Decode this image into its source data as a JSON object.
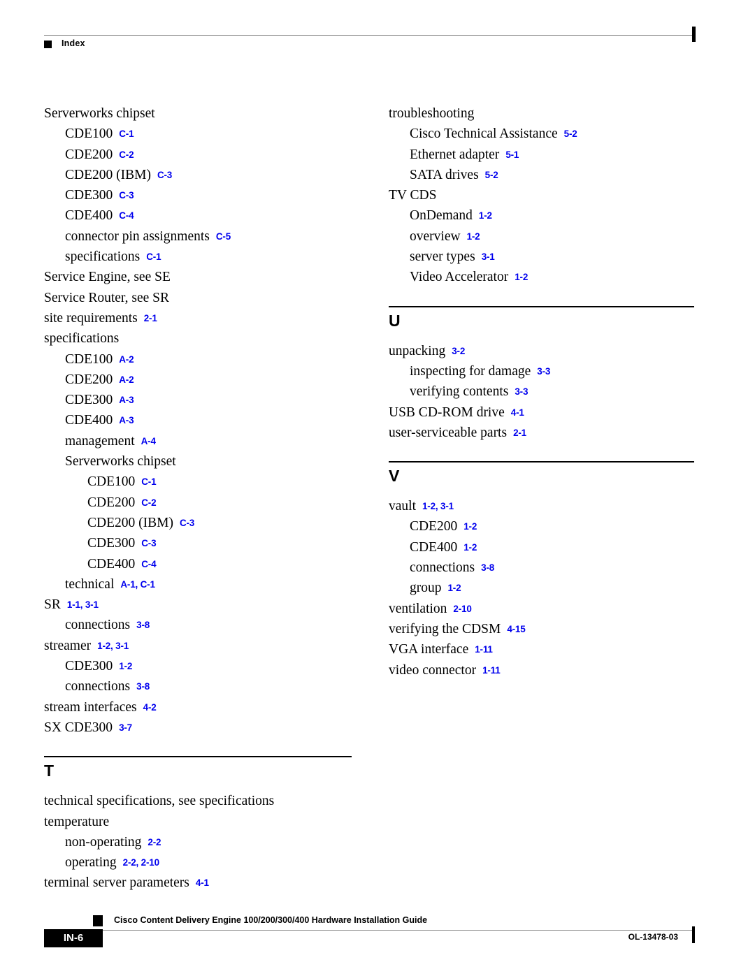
{
  "header": {
    "label": "Index"
  },
  "footer": {
    "page_number": "IN-6",
    "document_title": "Cisco Content Delivery Engine 100/200/300/400 Hardware Installation Guide",
    "doc_id": "OL-13478-03"
  },
  "colors": {
    "page_ref_blue": "#0000EE",
    "rule_gray": "#8a8a8a",
    "text_black": "#000000"
  },
  "columns": {
    "left": {
      "blocks": [
        {
          "type": "entries",
          "entries": [
            {
              "level": 0,
              "term": "Serverworks chipset",
              "refs": ""
            },
            {
              "level": 1,
              "term": "CDE100",
              "refs": "C-1"
            },
            {
              "level": 1,
              "term": "CDE200",
              "refs": "C-2"
            },
            {
              "level": 1,
              "term": "CDE200 (IBM)",
              "refs": "C-3"
            },
            {
              "level": 1,
              "term": "CDE300",
              "refs": "C-3"
            },
            {
              "level": 1,
              "term": "CDE400",
              "refs": "C-4"
            },
            {
              "level": 1,
              "term": "connector pin assignments",
              "refs": "C-5"
            },
            {
              "level": 1,
              "term": "specifications",
              "refs": "C-1"
            },
            {
              "level": 0,
              "term": "Service Engine, see SE",
              "refs": ""
            },
            {
              "level": 0,
              "term": "Service Router, see SR",
              "refs": ""
            },
            {
              "level": 0,
              "term": "site requirements",
              "refs": "2-1"
            },
            {
              "level": 0,
              "term": "specifications",
              "refs": ""
            },
            {
              "level": 1,
              "term": "CDE100",
              "refs": "A-2"
            },
            {
              "level": 1,
              "term": "CDE200",
              "refs": "A-2"
            },
            {
              "level": 1,
              "term": "CDE300",
              "refs": "A-3"
            },
            {
              "level": 1,
              "term": "CDE400",
              "refs": "A-3"
            },
            {
              "level": 1,
              "term": "management",
              "refs": "A-4"
            },
            {
              "level": 1,
              "term": "Serverworks chipset",
              "refs": ""
            },
            {
              "level": 2,
              "term": "CDE100",
              "refs": "C-1"
            },
            {
              "level": 2,
              "term": "CDE200",
              "refs": "C-2"
            },
            {
              "level": 2,
              "term": "CDE200 (IBM)",
              "refs": "C-3"
            },
            {
              "level": 2,
              "term": "CDE300",
              "refs": "C-3"
            },
            {
              "level": 2,
              "term": "CDE400",
              "refs": "C-4"
            },
            {
              "level": 1,
              "term": "technical",
              "refs": "A-1, C-1"
            },
            {
              "level": 0,
              "term": "SR",
              "refs": "1-1, 3-1"
            },
            {
              "level": 1,
              "term": "connections",
              "refs": "3-8"
            },
            {
              "level": 0,
              "term": "streamer",
              "refs": "1-2, 3-1"
            },
            {
              "level": 1,
              "term": "CDE300",
              "refs": "1-2"
            },
            {
              "level": 1,
              "term": "connections",
              "refs": "3-8"
            },
            {
              "level": 0,
              "term": "stream interfaces",
              "refs": "4-2"
            },
            {
              "level": 0,
              "term": "SX CDE300",
              "refs": "3-7"
            }
          ]
        },
        {
          "type": "letter",
          "letter": "T"
        },
        {
          "type": "entries",
          "entries": [
            {
              "level": 0,
              "term": "technical specifications, see specifications",
              "refs": ""
            },
            {
              "level": 0,
              "term": "temperature",
              "refs": ""
            },
            {
              "level": 1,
              "term": "non-operating",
              "refs": "2-2"
            },
            {
              "level": 1,
              "term": "operating",
              "refs": "2-2, 2-10"
            },
            {
              "level": 0,
              "term": "terminal server parameters",
              "refs": "4-1"
            }
          ]
        }
      ]
    },
    "right": {
      "blocks": [
        {
          "type": "entries",
          "entries": [
            {
              "level": 0,
              "term": "troubleshooting",
              "refs": ""
            },
            {
              "level": 1,
              "term": "Cisco Technical Assistance",
              "refs": "5-2"
            },
            {
              "level": 1,
              "term": "Ethernet adapter",
              "refs": "5-1"
            },
            {
              "level": 1,
              "term": "SATA drives",
              "refs": "5-2"
            },
            {
              "level": 0,
              "term": "TV CDS",
              "refs": ""
            },
            {
              "level": 1,
              "term": "OnDemand",
              "refs": "1-2"
            },
            {
              "level": 1,
              "term": "overview",
              "refs": "1-2"
            },
            {
              "level": 1,
              "term": "server types",
              "refs": "3-1"
            },
            {
              "level": 1,
              "term": "Video Accelerator",
              "refs": "1-2"
            }
          ]
        },
        {
          "type": "letter",
          "letter": "U"
        },
        {
          "type": "entries",
          "entries": [
            {
              "level": 0,
              "term": "unpacking",
              "refs": "3-2"
            },
            {
              "level": 1,
              "term": "inspecting for damage",
              "refs": "3-3"
            },
            {
              "level": 1,
              "term": "verifying contents",
              "refs": "3-3"
            },
            {
              "level": 0,
              "term": "USB CD-ROM drive",
              "refs": "4-1"
            },
            {
              "level": 0,
              "term": "user-serviceable parts",
              "refs": "2-1"
            }
          ]
        },
        {
          "type": "letter",
          "letter": "V"
        },
        {
          "type": "entries",
          "entries": [
            {
              "level": 0,
              "term": "vault",
              "refs": "1-2, 3-1"
            },
            {
              "level": 1,
              "term": "CDE200",
              "refs": "1-2"
            },
            {
              "level": 1,
              "term": "CDE400",
              "refs": "1-2"
            },
            {
              "level": 1,
              "term": "connections",
              "refs": "3-8"
            },
            {
              "level": 1,
              "term": "group",
              "refs": "1-2"
            },
            {
              "level": 0,
              "term": "ventilation",
              "refs": "2-10"
            },
            {
              "level": 0,
              "term": "verifying the CDSM",
              "refs": "4-15"
            },
            {
              "level": 0,
              "term": "VGA interface",
              "refs": "1-11"
            },
            {
              "level": 0,
              "term": "video connector",
              "refs": "1-11"
            }
          ]
        }
      ]
    }
  }
}
